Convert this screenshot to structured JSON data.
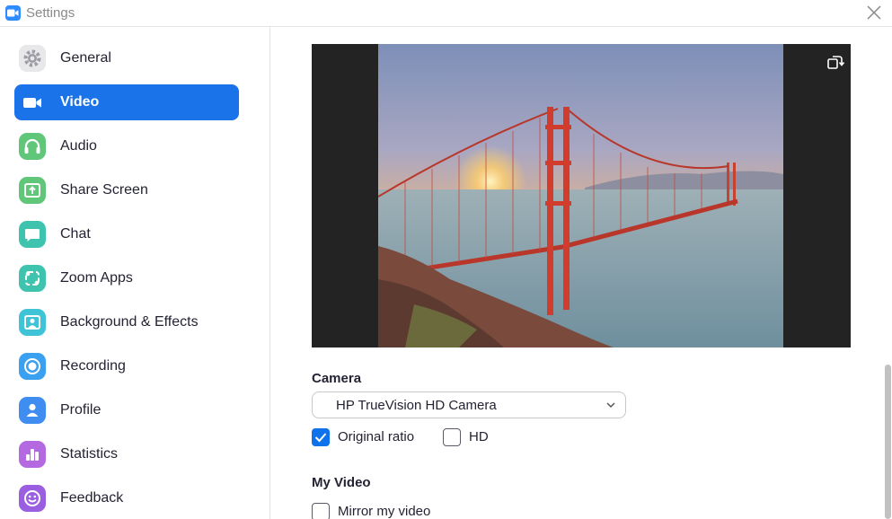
{
  "window": {
    "title": "Settings"
  },
  "sidebar": {
    "items": [
      {
        "label": "General",
        "icon": "gear-icon",
        "color": "#e8e8ea",
        "active": false
      },
      {
        "label": "Video",
        "icon": "video-camera-icon",
        "color": "#1a73e8",
        "active": true
      },
      {
        "label": "Audio",
        "icon": "headphones-icon",
        "color": "#5fc67a",
        "active": false
      },
      {
        "label": "Share Screen",
        "icon": "share-screen-icon",
        "color": "#5fc67a",
        "active": false
      },
      {
        "label": "Chat",
        "icon": "chat-bubble-icon",
        "color": "#3ec4ae",
        "active": false
      },
      {
        "label": "Zoom Apps",
        "icon": "zoom-apps-icon",
        "color": "#3ec4ae",
        "active": false
      },
      {
        "label": "Background & Effects",
        "icon": "background-effects-icon",
        "color": "#3fc3d6",
        "active": false
      },
      {
        "label": "Recording",
        "icon": "recording-icon",
        "color": "#3aa0ef",
        "active": false
      },
      {
        "label": "Profile",
        "icon": "profile-icon",
        "color": "#3f8df0",
        "active": false
      },
      {
        "label": "Statistics",
        "icon": "statistics-icon",
        "color": "#b469e0",
        "active": false
      },
      {
        "label": "Feedback",
        "icon": "feedback-smiley-icon",
        "color": "#9a5fe0",
        "active": false
      }
    ]
  },
  "video": {
    "camera_title": "Camera",
    "camera_selected": "HP TrueVision HD Camera",
    "original_ratio": {
      "label": "Original ratio",
      "checked": true
    },
    "hd": {
      "label": "HD",
      "checked": false
    },
    "my_video_title": "My Video",
    "mirror": {
      "label": "Mirror my video",
      "checked": false
    }
  },
  "colors": {
    "accent": "#0e72ed",
    "active_nav": "#1a73e8",
    "app_logo": "#2d8cff"
  }
}
